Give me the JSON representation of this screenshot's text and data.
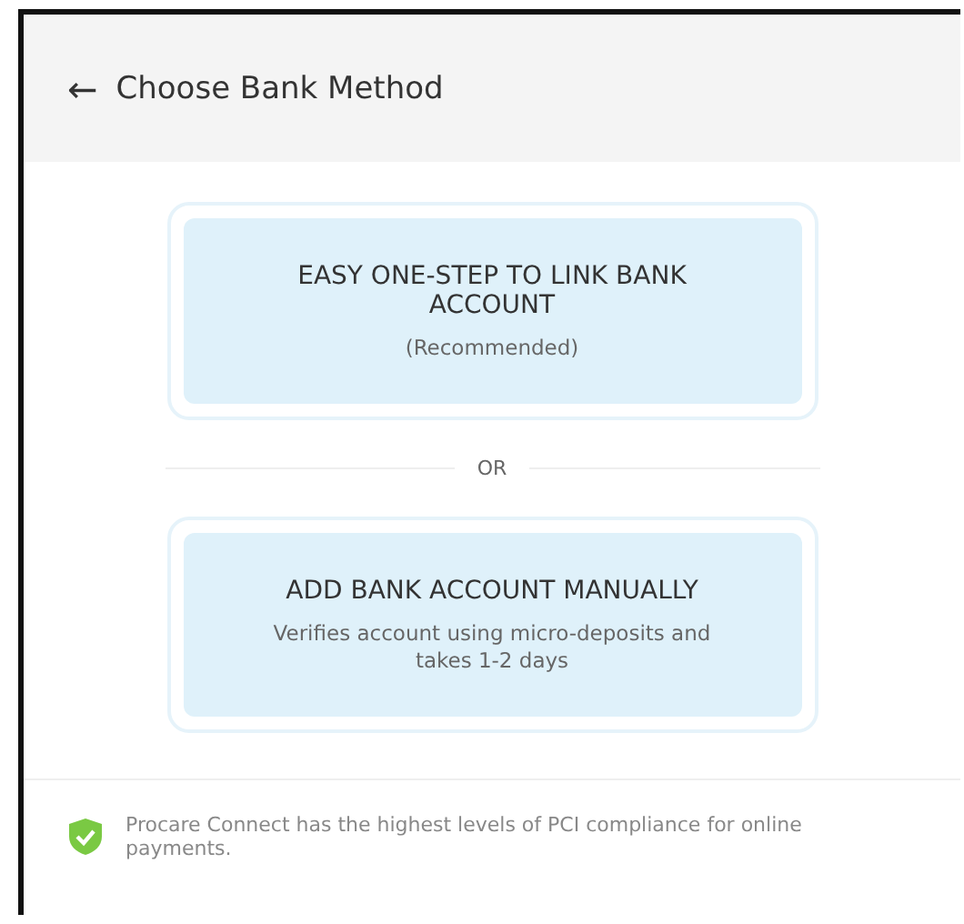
{
  "header": {
    "back_icon": "←",
    "title": "Choose Bank Method"
  },
  "options": [
    {
      "title": "EASY ONE-STEP TO LINK BANK ACCOUNT",
      "subtitle": "(Recommended)"
    },
    {
      "title": "ADD BANK ACCOUNT MANUALLY",
      "subtitle": "Verifies account using micro-deposits and takes 1-2 days"
    }
  ],
  "divider_text": "OR",
  "footer": {
    "text": "Procare Connect has the highest levels of PCI compliance for online payments."
  }
}
